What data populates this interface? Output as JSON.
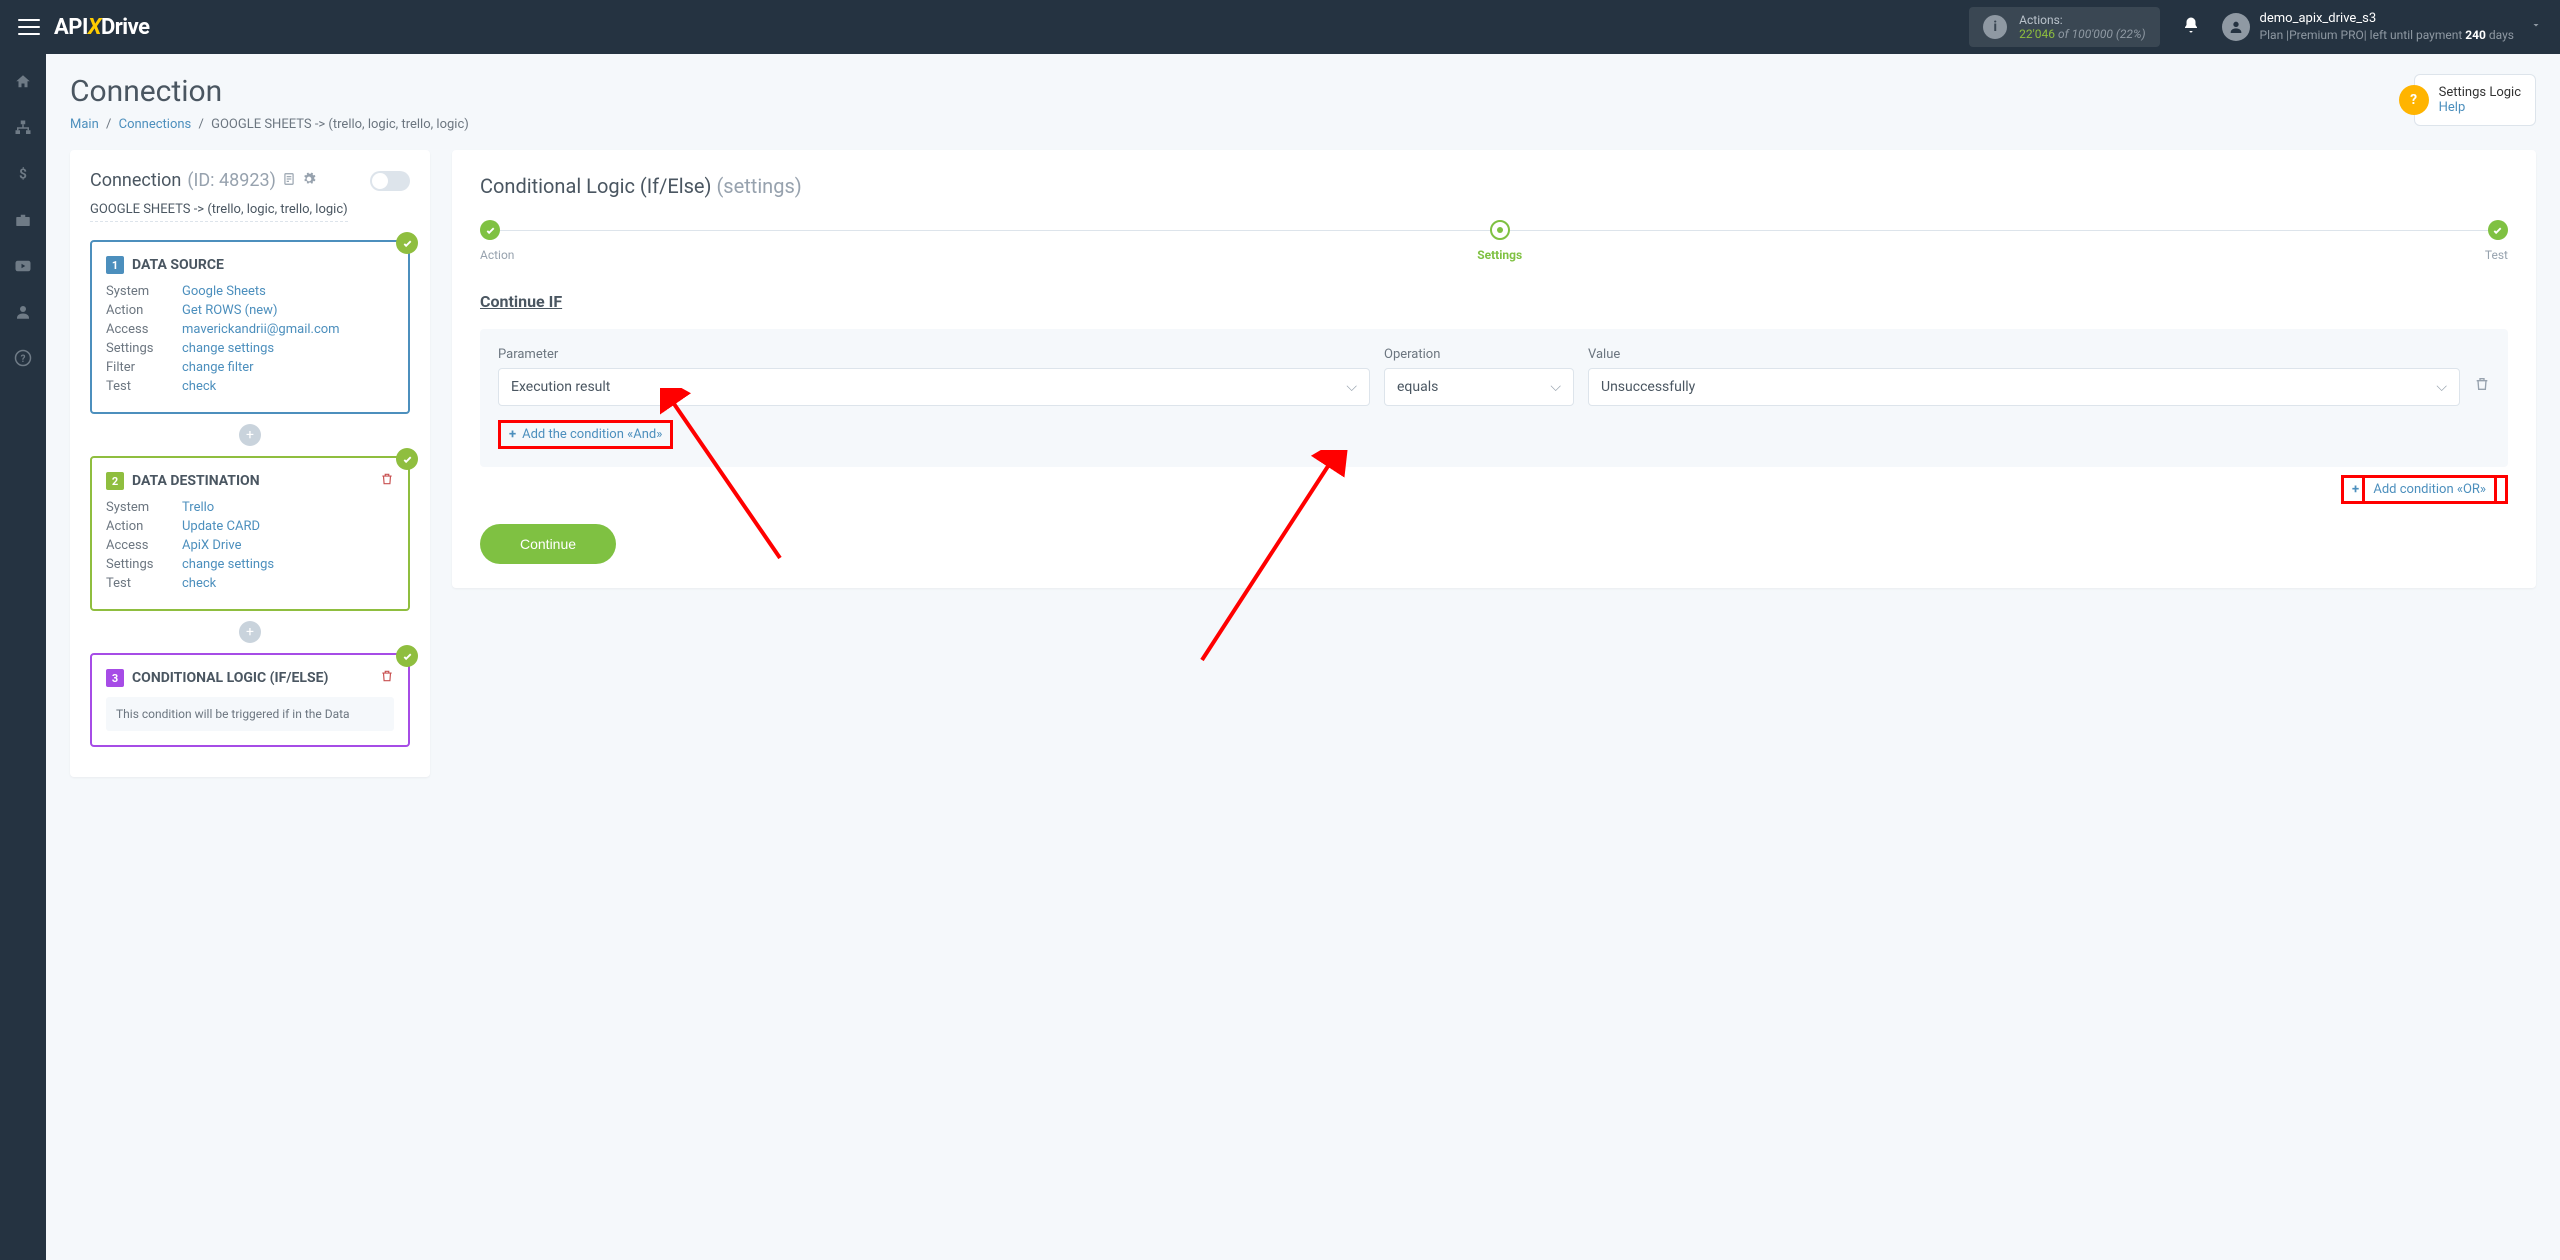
{
  "header": {
    "logo_parts": {
      "api": "API",
      "x": "X",
      "drive": "Drive"
    },
    "actions": {
      "label": "Actions:",
      "used": "22'046",
      "of": "of",
      "total": "100'000",
      "pct": "(22%)"
    },
    "user": {
      "name": "demo_apix_drive_s3",
      "plan_pre": "Plan |Premium PRO| left until payment ",
      "plan_days": "240",
      "plan_post": " days"
    }
  },
  "page": {
    "title": "Connection",
    "breadcrumb": {
      "main": "Main",
      "connections": "Connections",
      "current": "GOOGLE SHEETS -> (trello, logic, trello, logic)"
    },
    "help": {
      "title": "Settings Logic",
      "link": "Help"
    }
  },
  "connection": {
    "title": "Connection ",
    "id": "(ID: 48923)",
    "path": "GOOGLE SHEETS -> (trello, logic, trello, logic)"
  },
  "blocks": {
    "source": {
      "num": "1",
      "title": "DATA SOURCE",
      "rows": [
        {
          "lbl": "System",
          "val": "Google Sheets"
        },
        {
          "lbl": "Action",
          "val": "Get ROWS (new)"
        },
        {
          "lbl": "Access",
          "val": "maverickandrii@gmail.com"
        },
        {
          "lbl": "Settings",
          "val": "change settings"
        },
        {
          "lbl": "Filter",
          "val": "change filter"
        },
        {
          "lbl": "Test",
          "val": "check"
        }
      ]
    },
    "dest": {
      "num": "2",
      "title": "DATA DESTINATION",
      "rows": [
        {
          "lbl": "System",
          "val": "Trello"
        },
        {
          "lbl": "Action",
          "val": "Update CARD"
        },
        {
          "lbl": "Access",
          "val": "ApiX Drive"
        },
        {
          "lbl": "Settings",
          "val": "change settings"
        },
        {
          "lbl": "Test",
          "val": "check"
        }
      ]
    },
    "logic": {
      "num": "3",
      "title": "CONDITIONAL LOGIC (IF/ELSE)",
      "note": "This condition will be triggered if in the Data"
    }
  },
  "main": {
    "title": "Conditional Logic (If/Else)",
    "subtitle": "(settings)",
    "steps": {
      "action": "Action",
      "settings": "Settings",
      "test": "Test"
    },
    "section": "Continue IF",
    "labels": {
      "parameter": "Parameter",
      "operation": "Operation",
      "value": "Value"
    },
    "values": {
      "parameter": "Execution result",
      "operation": "equals",
      "value": "Unsuccessfully"
    },
    "add_and": "Add the condition «And»",
    "add_or": "Add condition «OR»",
    "continue": "Continue"
  }
}
